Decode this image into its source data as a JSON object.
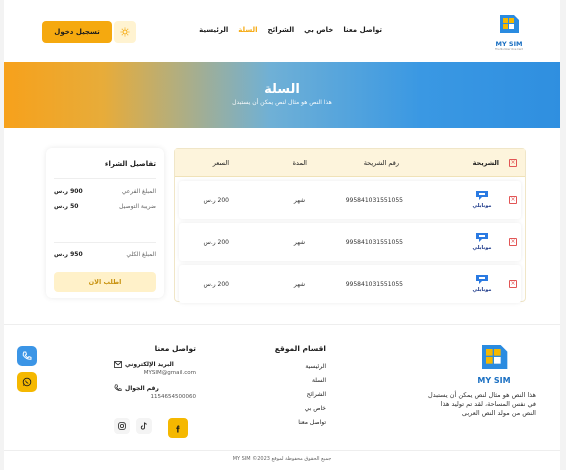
{
  "header": {
    "login_label": "تسجيل دخول",
    "nav": [
      "الرئيسية",
      "السلة",
      "الشرائح",
      "خاص بي",
      "تواصل معنا"
    ],
    "active_index": 1,
    "logo_text": "MY SIM",
    "logo_sub": "The Number One Card"
  },
  "banner": {
    "title": "السلة",
    "subtitle": "هذا النص هو مثال لنص يمكن أن يستبدل"
  },
  "cart": {
    "headers": {
      "sim": "الشريحة",
      "number": "رقم الشريحة",
      "duration": "المدة",
      "price": "السعر"
    },
    "rows": [
      {
        "brand": "موبايلي",
        "number": "995841031551055",
        "duration": "شهر",
        "price": "200 ر.س"
      },
      {
        "brand": "موبايلي",
        "number": "995841031551055",
        "duration": "شهر",
        "price": "200 ر.س"
      },
      {
        "brand": "موبايلي",
        "number": "995841031551055",
        "duration": "شهر",
        "price": "200 ر.س"
      }
    ]
  },
  "summary": {
    "title": "تفاصيل الشراء",
    "subtotal_label": "المبلغ الفرعي",
    "subtotal_value": "900 ر.س",
    "delivery_label": "ضريبة التوصيل",
    "delivery_value": "50 ر.س",
    "total_label": "المبلغ الكلي",
    "total_value": "950 ر.س",
    "order_label": "اطلب الان"
  },
  "footer": {
    "logo_text": "MY SIM",
    "about_text": "هذا النص هو مثال لنص يمكن أن يستبدل في نفس المساحة، لقد تم توليد هذا النص من مولد النص العربى",
    "links_title": "اقسام الموقع",
    "links": [
      "الرئيسية",
      "السلة",
      "الشرائح",
      "خاص بي",
      "تواصل معنا"
    ],
    "contact_title": "تواصل معنا",
    "email_label": "البريد الإلكتروني",
    "email_value": "MYSIM@gmail.com",
    "phone_label": "رقم الجوال",
    "phone_value": "1154654500060",
    "copyright": "جميع الحقوق محفوظة لموقع 2023© MY SIM"
  },
  "colors": {
    "accent": "#f5a90f",
    "blue": "#3b95e6",
    "danger": "#e25555"
  }
}
